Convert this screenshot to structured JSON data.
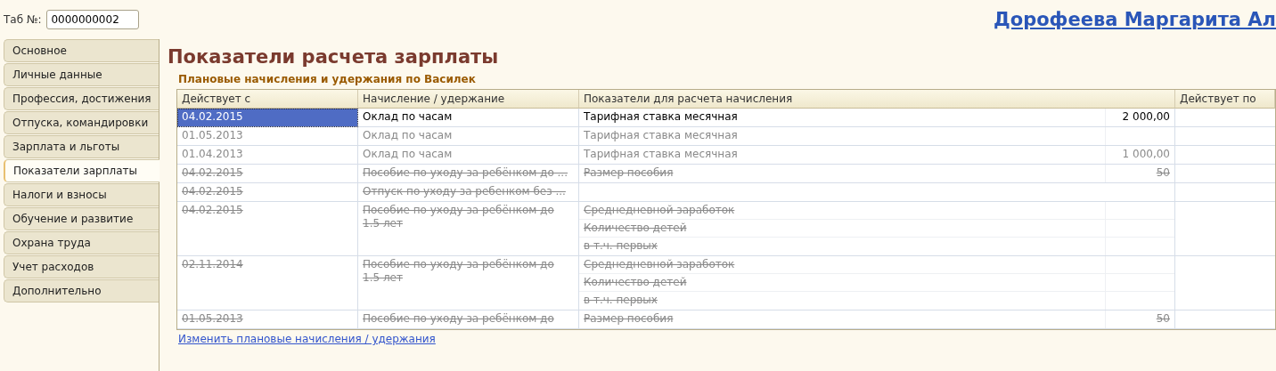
{
  "header": {
    "tab_label": "Таб №:",
    "tab_number": "0000000002",
    "employee_name": "Дорофеева Маргарита Ал"
  },
  "sidebar": {
    "items": [
      {
        "label": "Основное",
        "selected": false
      },
      {
        "label": "Личные данные",
        "selected": false
      },
      {
        "label": "Профессия, достижения",
        "selected": false
      },
      {
        "label": "Отпуска, командировки",
        "selected": false
      },
      {
        "label": "Зарплата и льготы",
        "selected": false
      },
      {
        "label": "Показатели зарплаты",
        "selected": true
      },
      {
        "label": "Налоги и взносы",
        "selected": false
      },
      {
        "label": "Обучение и развитие",
        "selected": false
      },
      {
        "label": "Охрана труда",
        "selected": false
      },
      {
        "label": "Учет расходов",
        "selected": false
      },
      {
        "label": "Дополнительно",
        "selected": false
      }
    ]
  },
  "page_title": "Показатели расчета зарплаты",
  "section_title": "Плановые начисления и удержания по Василек",
  "table": {
    "columns": [
      "Действует с",
      "Начисление / удержание",
      "Показатели для расчета начисления",
      "Действует по"
    ],
    "rows": [
      {
        "date": "04.02.2015",
        "accrual": "Оклад по часам",
        "greyed": false,
        "struck": false,
        "selected": true,
        "indicators": [
          {
            "name": "Тарифная ставка месячная",
            "value": "2 000,00"
          }
        ]
      },
      {
        "date": "01.05.2013",
        "accrual": "Оклад по часам",
        "greyed": true,
        "struck": false,
        "selected": false,
        "indicators": [
          {
            "name": "Тарифная ставка месячная"
          }
        ]
      },
      {
        "date": "01.04.2013",
        "accrual": "Оклад по часам",
        "greyed": true,
        "struck": false,
        "selected": false,
        "indicators": [
          {
            "name": "Тарифная ставка месячная",
            "value": "1 000,00"
          }
        ]
      },
      {
        "date": "04.02.2015",
        "accrual": "Пособие по уходу за ребёнком до ...",
        "greyed": true,
        "struck": true,
        "selected": false,
        "indicators": [
          {
            "name": "Размер пособия",
            "value": "50"
          }
        ]
      },
      {
        "date": "04.02.2015",
        "accrual": "Отпуск по уходу за ребенком без ...",
        "greyed": true,
        "struck": true,
        "selected": false,
        "indicators": []
      },
      {
        "date": "04.02.2015",
        "accrual": "Пособие по уходу за ребёнком до 1.5 лет",
        "greyed": true,
        "struck": true,
        "selected": false,
        "indicators": [
          {
            "name": "Среднедневной заработок"
          },
          {
            "name": "Количество детей"
          },
          {
            "name": "в т.ч. первых"
          }
        ]
      },
      {
        "date": "02.11.2014",
        "accrual": "Пособие по уходу за ребёнком до 1.5 лет",
        "greyed": true,
        "struck": true,
        "selected": false,
        "indicators": [
          {
            "name": "Среднедневной заработок"
          },
          {
            "name": "Количество детей"
          },
          {
            "name": "в т.ч. первых"
          }
        ]
      },
      {
        "date": "01.05.2013",
        "accrual": "Пособие по уходу за ребёнком до",
        "greyed": true,
        "struck": true,
        "selected": false,
        "indicators": [
          {
            "name": "Размер пособия",
            "value": "50"
          }
        ]
      }
    ]
  },
  "link": "Изменить плановые начисления / удержания"
}
